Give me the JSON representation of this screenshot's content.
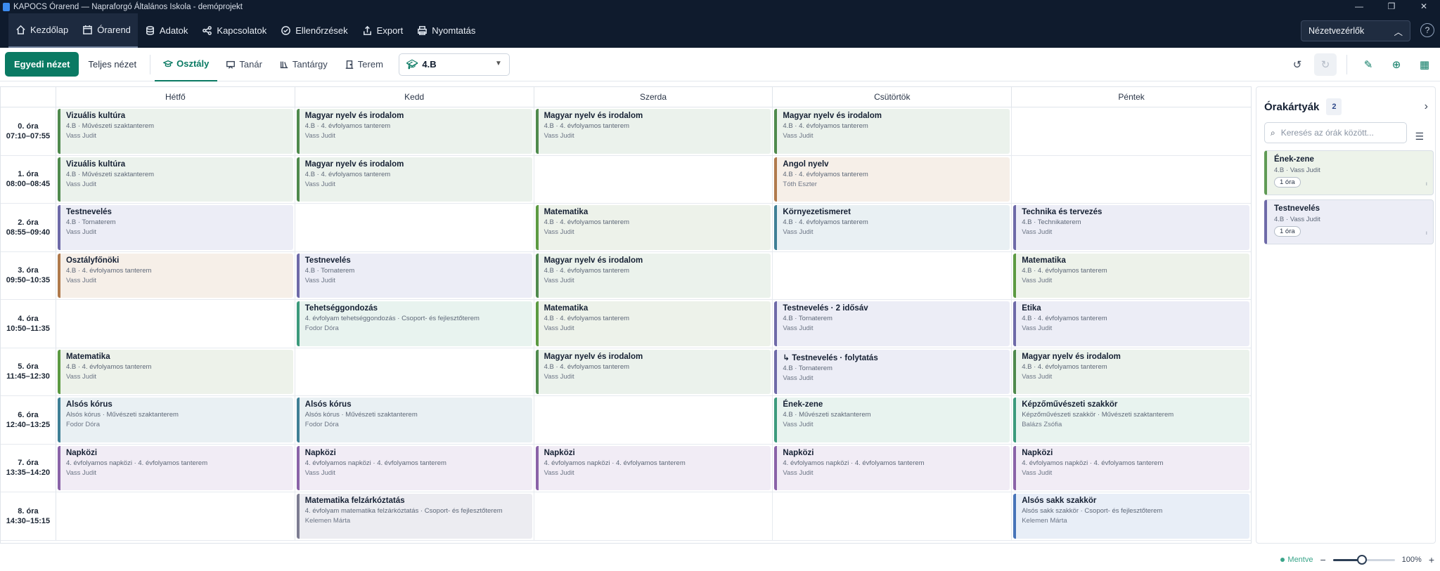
{
  "window": {
    "title": "KAPOCS Órarend — Napraforgó Általános Iskola - demóprojekt",
    "controls": [
      "—",
      "❐",
      "✕"
    ]
  },
  "topnav": {
    "items": [
      {
        "label": "Kezdőlap",
        "icon": "home-icon"
      },
      {
        "label": "Órarend",
        "icon": "calendar-icon"
      },
      {
        "label": "Adatok",
        "icon": "database-icon"
      },
      {
        "label": "Kapcsolatok",
        "icon": "share-icon"
      },
      {
        "label": "Ellenőrzések",
        "icon": "check-circle-icon"
      },
      {
        "label": "Export",
        "icon": "upload-icon"
      },
      {
        "label": "Nyomtatás",
        "icon": "printer-icon"
      }
    ],
    "view_selector_label": "Nézetvezérlők",
    "help": "?"
  },
  "toolbar": {
    "primary_view": "Egyedi nézet",
    "full_view": "Teljes nézet",
    "filter_tabs": [
      "Osztály",
      "Tanár",
      "Tantárgy",
      "Terem"
    ],
    "selected_class": "4.B"
  },
  "grid": {
    "days": [
      "Hétfő",
      "Kedd",
      "Szerda",
      "Csütörtök",
      "Péntek"
    ],
    "periods": [
      {
        "name": "0. óra",
        "time": "07:10–07:55"
      },
      {
        "name": "1. óra",
        "time": "08:00–08:45"
      },
      {
        "name": "2. óra",
        "time": "08:55–09:40"
      },
      {
        "name": "3. óra",
        "time": "09:50–10:35"
      },
      {
        "name": "4. óra",
        "time": "10:50–11:35"
      },
      {
        "name": "5. óra",
        "time": "11:45–12:30"
      },
      {
        "name": "6. óra",
        "time": "12:40–13:25"
      },
      {
        "name": "7. óra",
        "time": "13:35–14:20"
      },
      {
        "name": "8. óra",
        "time": "14:30–15:15"
      }
    ],
    "rows": [
      [
        {
          "subject": "Vizuális kultúra",
          "meta": "4.B  ·  Művészeti szaktanterem",
          "teacher": "Vass Judit",
          "bg": "#ebf2ec",
          "border": "#4f8a4d"
        },
        {
          "subject": "Magyar nyelv és irodalom",
          "meta": "4.B  ·  4. évfolyamos tanterem",
          "teacher": "Vass Judit",
          "bg": "#ebf2ec",
          "border": "#4f8a4d"
        },
        {
          "subject": "Magyar nyelv és irodalom",
          "meta": "4.B  ·  4. évfolyamos tanterem",
          "teacher": "Vass Judit",
          "bg": "#ebf2ec",
          "border": "#4f8a4d"
        },
        {
          "subject": "Magyar nyelv és irodalom",
          "meta": "4.B  ·  4. évfolyamos tanterem",
          "teacher": "Vass Judit",
          "bg": "#ebf2ec",
          "border": "#4f8a4d"
        },
        null
      ],
      [
        {
          "subject": "Vizuális kultúra",
          "meta": "4.B  ·  Művészeti szaktanterem",
          "teacher": "Vass Judit",
          "bg": "#ebf2ec",
          "border": "#4f8a4d"
        },
        {
          "subject": "Magyar nyelv és irodalom",
          "meta": "4.B  ·  4. évfolyamos tanterem",
          "teacher": "Vass Judit",
          "bg": "#ebf2ec",
          "border": "#4f8a4d"
        },
        null,
        {
          "subject": "Angol nyelv",
          "meta": "4.B  ·  4. évfolyamos tanterem",
          "teacher": "Tóth Eszter",
          "bg": "#f6efe8",
          "border": "#b07a4c"
        },
        null
      ],
      [
        {
          "subject": "Testnevelés",
          "meta": "4.B  ·  Tornaterem",
          "teacher": "Vass Judit",
          "bg": "#ecedf6",
          "border": "#6e6aa8"
        },
        null,
        {
          "subject": "Matematika",
          "meta": "4.B  ·  4. évfolyamos tanterem",
          "teacher": "Vass Judit",
          "bg": "#edf2ea",
          "border": "#5c9a42"
        },
        {
          "subject": "Környezetismeret",
          "meta": "4.B  ·  4. évfolyamos tanterem",
          "teacher": "Vass Judit",
          "bg": "#e9f0f3",
          "border": "#3f7f95"
        },
        {
          "subject": "Technika és tervezés",
          "meta": "4.B  ·  Technikaterem",
          "teacher": "Vass Judit",
          "bg": "#ecedf6",
          "border": "#6e6aa8"
        }
      ],
      [
        {
          "subject": "Osztályfőnöki",
          "meta": "4.B  ·  4. évfolyamos tanterem",
          "teacher": "Vass Judit",
          "bg": "#f6efe8",
          "border": "#b07a4c"
        },
        {
          "subject": "Testnevelés",
          "meta": "4.B  ·  Tornaterem",
          "teacher": "Vass Judit",
          "bg": "#ecedf6",
          "border": "#6e6aa8"
        },
        {
          "subject": "Magyar nyelv és irodalom",
          "meta": "4.B  ·  4. évfolyamos tanterem",
          "teacher": "Vass Judit",
          "bg": "#ebf2ec",
          "border": "#4f8a4d"
        },
        null,
        {
          "subject": "Matematika",
          "meta": "4.B  ·  4. évfolyamos tanterem",
          "teacher": "Vass Judit",
          "bg": "#edf2ea",
          "border": "#5c9a42"
        }
      ],
      [
        null,
        {
          "subject": "Tehetséggondozás",
          "meta": "4. évfolyam tehetséggondozás  ·  Csoport- és fejlesztőterem",
          "teacher": "Fodor Dóra",
          "bg": "#e8f3ef",
          "border": "#3c9a7c"
        },
        {
          "subject": "Matematika",
          "meta": "4.B  ·  4. évfolyamos tanterem",
          "teacher": "Vass Judit",
          "bg": "#edf2ea",
          "border": "#5c9a42"
        },
        {
          "subject": "Testnevelés · 2 idősáv",
          "meta": "4.B  ·  Tornaterem",
          "teacher": "Vass Judit",
          "bg": "#ecedf6",
          "border": "#6e6aa8"
        },
        {
          "subject": "Etika",
          "meta": "4.B  ·  4. évfolyamos tanterem",
          "teacher": "Vass Judit",
          "bg": "#ecedf6",
          "border": "#6e6aa8"
        }
      ],
      [
        {
          "subject": "Matematika",
          "meta": "4.B  ·  4. évfolyamos tanterem",
          "teacher": "Vass Judit",
          "bg": "#edf2ea",
          "border": "#5c9a42"
        },
        null,
        {
          "subject": "Magyar nyelv és irodalom",
          "meta": "4.B  ·  4. évfolyamos tanterem",
          "teacher": "Vass Judit",
          "bg": "#ebf2ec",
          "border": "#4f8a4d"
        },
        {
          "subject": "↳ Testnevelés · folytatás",
          "meta": "4.B  ·  Tornaterem",
          "teacher": "Vass Judit",
          "bg": "#ecedf6",
          "border": "#6e6aa8"
        },
        {
          "subject": "Magyar nyelv és irodalom",
          "meta": "4.B  ·  4. évfolyamos tanterem",
          "teacher": "Vass Judit",
          "bg": "#ebf2ec",
          "border": "#4f8a4d"
        }
      ],
      [
        {
          "subject": "Alsós kórus",
          "meta": "Alsós kórus  ·  Művészeti szaktanterem",
          "teacher": "Fodor Dóra",
          "bg": "#e9f0f3",
          "border": "#3f7f95"
        },
        {
          "subject": "Alsós kórus",
          "meta": "Alsós kórus  ·  Művészeti szaktanterem",
          "teacher": "Fodor Dóra",
          "bg": "#e9f0f3",
          "border": "#3f7f95"
        },
        null,
        {
          "subject": "Ének-zene",
          "meta": "4.B  ·  Művészeti szaktanterem",
          "teacher": "Vass Judit",
          "bg": "#e8f3ef",
          "border": "#3c9a7c"
        },
        {
          "subject": "Képzőművészeti szakkör",
          "meta": "Képzőművészeti szakkör  ·  Művészeti szaktanterem",
          "teacher": "Balázs Zsófia",
          "bg": "#e8f3ef",
          "border": "#3c9a7c"
        }
      ],
      [
        {
          "subject": "Napközi",
          "meta": "4. évfolyamos napközi  ·  4. évfolyamos tanterem",
          "teacher": "Vass Judit",
          "bg": "#f1ecf5",
          "border": "#8a63a8"
        },
        {
          "subject": "Napközi",
          "meta": "4. évfolyamos napközi  ·  4. évfolyamos tanterem",
          "teacher": "Vass Judit",
          "bg": "#f1ecf5",
          "border": "#8a63a8"
        },
        {
          "subject": "Napközi",
          "meta": "4. évfolyamos napközi  ·  4. évfolyamos tanterem",
          "teacher": "Vass Judit",
          "bg": "#f1ecf5",
          "border": "#8a63a8"
        },
        {
          "subject": "Napközi",
          "meta": "4. évfolyamos napközi  ·  4. évfolyamos tanterem",
          "teacher": "Vass Judit",
          "bg": "#f1ecf5",
          "border": "#8a63a8"
        },
        {
          "subject": "Napközi",
          "meta": "4. évfolyamos napközi  ·  4. évfolyamos tanterem",
          "teacher": "Vass Judit",
          "bg": "#f1ecf5",
          "border": "#8a63a8"
        }
      ],
      [
        null,
        {
          "subject": "Matematika felzárkóztatás",
          "meta": "4. évfolyam matematika felzárkóztatás  ·  Csoport- és fejlesztőterem",
          "teacher": "Kelemen Márta",
          "bg": "#ececf1",
          "border": "#7d7d92"
        },
        null,
        null,
        {
          "subject": "Alsós sakk szakkör",
          "meta": "Alsós sakk szakkör  ·  Csoport- és fejlesztőterem",
          "teacher": "Kelemen Márta",
          "bg": "#e8eef7",
          "border": "#4774b8"
        }
      ]
    ]
  },
  "panel": {
    "title": "Órakártyák",
    "count": "2",
    "search_placeholder": "Keresés az órák között...",
    "cards": [
      {
        "subject": "Ének-zene",
        "meta": "4.B  ·  Vass Judit",
        "badge": "1 óra",
        "dot": "ı"
      },
      {
        "subject": "Testnevelés",
        "meta": "4.B  ·  Vass Judit",
        "badge": "1 óra",
        "dot": "ı",
        "bg": "#ecedf6",
        "border": "#6e6aa8"
      }
    ]
  },
  "status": {
    "saved": "Mentve",
    "zoom_minus": "−",
    "zoom_value": "100%",
    "zoom_plus": "+",
    "zoom_level": 0.47
  },
  "colors": {
    "accent": "#0a7a63",
    "nav_bg": "#0f1b2d"
  }
}
